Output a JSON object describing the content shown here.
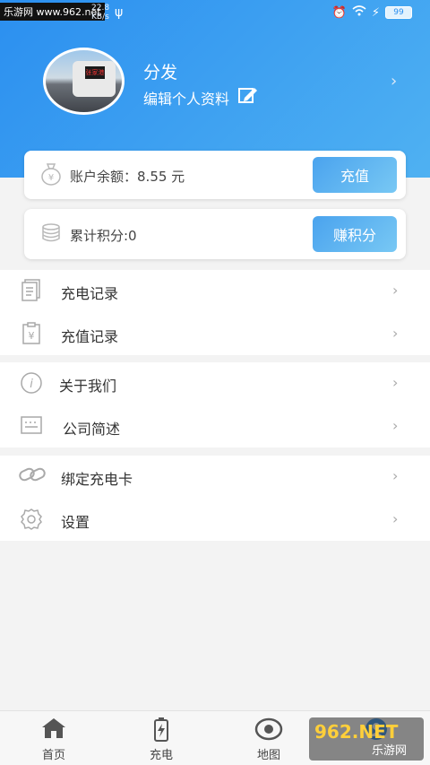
{
  "status_bar": {
    "watermark": "乐游网 www.962.net",
    "net_speed": "22.8",
    "net_unit": "KB/s",
    "battery": "99",
    "usb_icon": "usb-icon",
    "right_icons": [
      "alarm-icon",
      "wifi-icon",
      "charging-icon"
    ]
  },
  "profile": {
    "username": "分发",
    "edit_label": "编辑个人资料",
    "edit_icon": "edit-icon",
    "avatar_sign": "张家港"
  },
  "balance_card": {
    "label": "账户余额：",
    "amount": "8.55 元",
    "button": "充值",
    "icon": "money-bag-icon"
  },
  "points_card": {
    "label": "累计积分:0",
    "button": "赚积分",
    "icon": "coins-icon"
  },
  "menu": [
    {
      "label": "充电记录",
      "icon": "document-icon"
    },
    {
      "label": "充值记录",
      "icon": "yen-clipboard-icon"
    },
    {
      "label": "关于我们",
      "icon": "info-icon"
    },
    {
      "label": "公司简述",
      "icon": "card-text-icon"
    },
    {
      "label": "绑定充电卡",
      "icon": "link-icon"
    },
    {
      "label": "设置",
      "icon": "gear-icon"
    }
  ],
  "tabs": [
    {
      "label": "首页",
      "icon": "home-icon"
    },
    {
      "label": "充电",
      "icon": "battery-charge-icon"
    },
    {
      "label": "地图",
      "icon": "map-pin-icon"
    },
    {
      "label": "",
      "icon": "user-icon"
    }
  ],
  "brand_watermark": {
    "big": "962.NET",
    "small": "乐游网"
  },
  "colors": {
    "header_start": "#2b8ff0",
    "header_end": "#4fb1f2",
    "button": "#4aa3ee",
    "background": "#f3f3f3"
  }
}
